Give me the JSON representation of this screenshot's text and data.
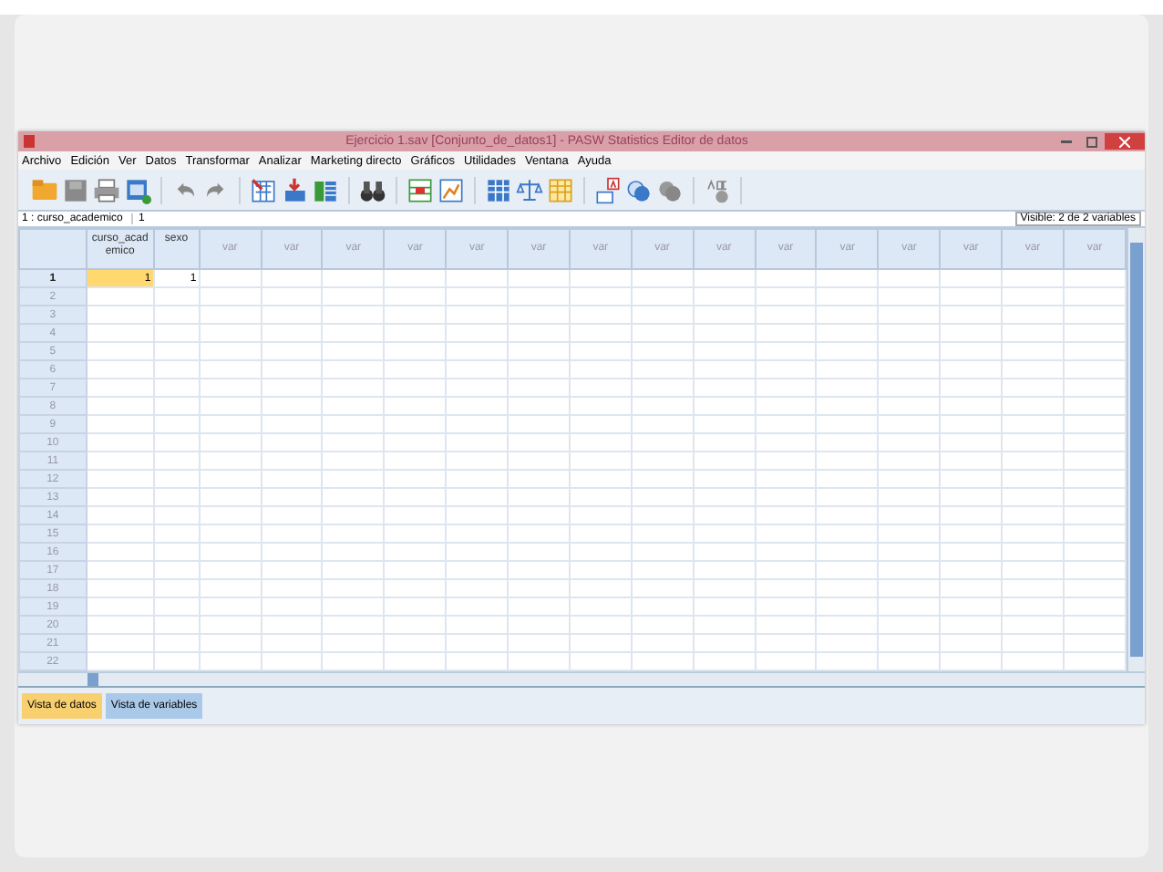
{
  "window": {
    "title": "Ejercicio 1.sav [Conjunto_de_datos1] - PASW Statistics Editor de datos"
  },
  "menu": [
    "Archivo",
    "Edición",
    "Ver",
    "Datos",
    "Transformar",
    "Analizar",
    "Marketing directo",
    "Gráficos",
    "Utilidades",
    "Ventana",
    "Ayuda"
  ],
  "cell_editor": {
    "cell_ref": "1 : curso_academico",
    "value": "1"
  },
  "visible_count": "Visible: 2 de 2 variables",
  "columns": [
    "curso_academico",
    "sexo",
    "var",
    "var",
    "var",
    "var",
    "var",
    "var",
    "var",
    "var",
    "var",
    "var",
    "var",
    "var",
    "var",
    "var",
    "var"
  ],
  "rows": [
    {
      "label": "1",
      "selected": true,
      "cells": [
        {
          "value": "1",
          "selected": true
        },
        {
          "value": "1",
          "selected": false
        }
      ]
    },
    {
      "label": "2",
      "selected": false
    },
    {
      "label": "3",
      "selected": false
    },
    {
      "label": "4",
      "selected": false
    },
    {
      "label": "5",
      "selected": false
    },
    {
      "label": "6",
      "selected": false
    },
    {
      "label": "7",
      "selected": false
    },
    {
      "label": "8",
      "selected": false
    },
    {
      "label": "9",
      "selected": false
    },
    {
      "label": "10",
      "selected": false
    },
    {
      "label": "11",
      "selected": false
    },
    {
      "label": "12",
      "selected": false
    },
    {
      "label": "13",
      "selected": false
    },
    {
      "label": "14",
      "selected": false
    },
    {
      "label": "15",
      "selected": false
    },
    {
      "label": "16",
      "selected": false
    },
    {
      "label": "17",
      "selected": false
    },
    {
      "label": "18",
      "selected": false
    },
    {
      "label": "19",
      "selected": false
    },
    {
      "label": "20",
      "selected": false
    },
    {
      "label": "21",
      "selected": false
    },
    {
      "label": "22",
      "selected": false
    }
  ],
  "tabs": [
    {
      "label": "Vista de datos",
      "selected": true
    },
    {
      "label": "Vista de variables",
      "selected": false
    }
  ]
}
